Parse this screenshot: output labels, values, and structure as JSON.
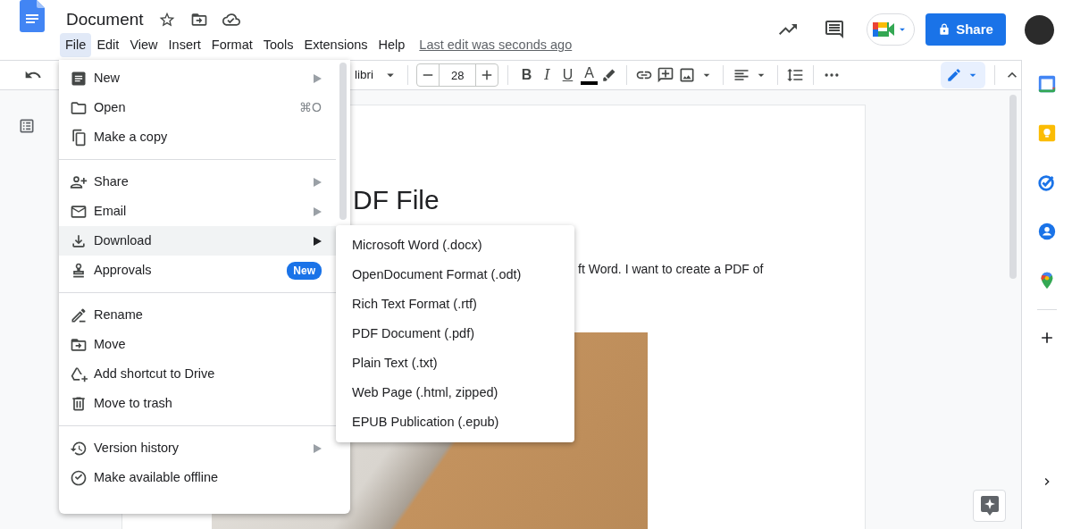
{
  "document_title": "Document",
  "menubar": [
    {
      "label": "File",
      "selected": true
    },
    {
      "label": "Edit",
      "selected": false
    },
    {
      "label": "View",
      "selected": false
    },
    {
      "label": "Insert",
      "selected": false
    },
    {
      "label": "Format",
      "selected": false
    },
    {
      "label": "Tools",
      "selected": false
    },
    {
      "label": "Extensions",
      "selected": false
    },
    {
      "label": "Help",
      "selected": false
    }
  ],
  "last_edit": "Last edit was seconds ago",
  "share_button": "Share",
  "toolbar": {
    "font": "libri",
    "font_size": "28",
    "bold": "B",
    "italic": "I",
    "underline": "U",
    "text_color": "A",
    "edit_mode_selected": true
  },
  "document": {
    "heading": "DF File",
    "paragraph": "ft Word.  I want to create a PDF of"
  },
  "file_menu": [
    {
      "items": [
        {
          "label": "New",
          "has_submenu": true,
          "selected": false
        },
        {
          "label": "Open",
          "shortcut": "⌘O",
          "has_submenu": false,
          "selected": false
        },
        {
          "label": "Make a copy",
          "has_submenu": false,
          "selected": false
        }
      ]
    },
    {
      "items": [
        {
          "label": "Share",
          "has_submenu": true,
          "selected": false
        },
        {
          "label": "Email",
          "has_submenu": true,
          "selected": false
        },
        {
          "label": "Download",
          "has_submenu": true,
          "selected": true
        },
        {
          "label": "Approvals",
          "badge": "New",
          "has_submenu": false,
          "selected": false
        }
      ]
    },
    {
      "items": [
        {
          "label": "Rename",
          "has_submenu": false,
          "selected": false
        },
        {
          "label": "Move",
          "has_submenu": false,
          "selected": false
        },
        {
          "label": "Add shortcut to Drive",
          "has_submenu": false,
          "selected": false
        },
        {
          "label": "Move to trash",
          "has_submenu": false,
          "selected": false
        }
      ]
    },
    {
      "items": [
        {
          "label": "Version history",
          "has_submenu": true,
          "selected": false
        },
        {
          "label": "Make available offline",
          "has_submenu": false,
          "selected": false
        }
      ]
    }
  ],
  "download_submenu": [
    {
      "label": "Microsoft Word (.docx)"
    },
    {
      "label": "OpenDocument Format (.odt)"
    },
    {
      "label": "Rich Text Format (.rtf)"
    },
    {
      "label": "PDF Document (.pdf)"
    },
    {
      "label": "Plain Text (.txt)"
    },
    {
      "label": "Web Page (.html, zipped)"
    },
    {
      "label": "EPUB Publication (.epub)"
    }
  ]
}
